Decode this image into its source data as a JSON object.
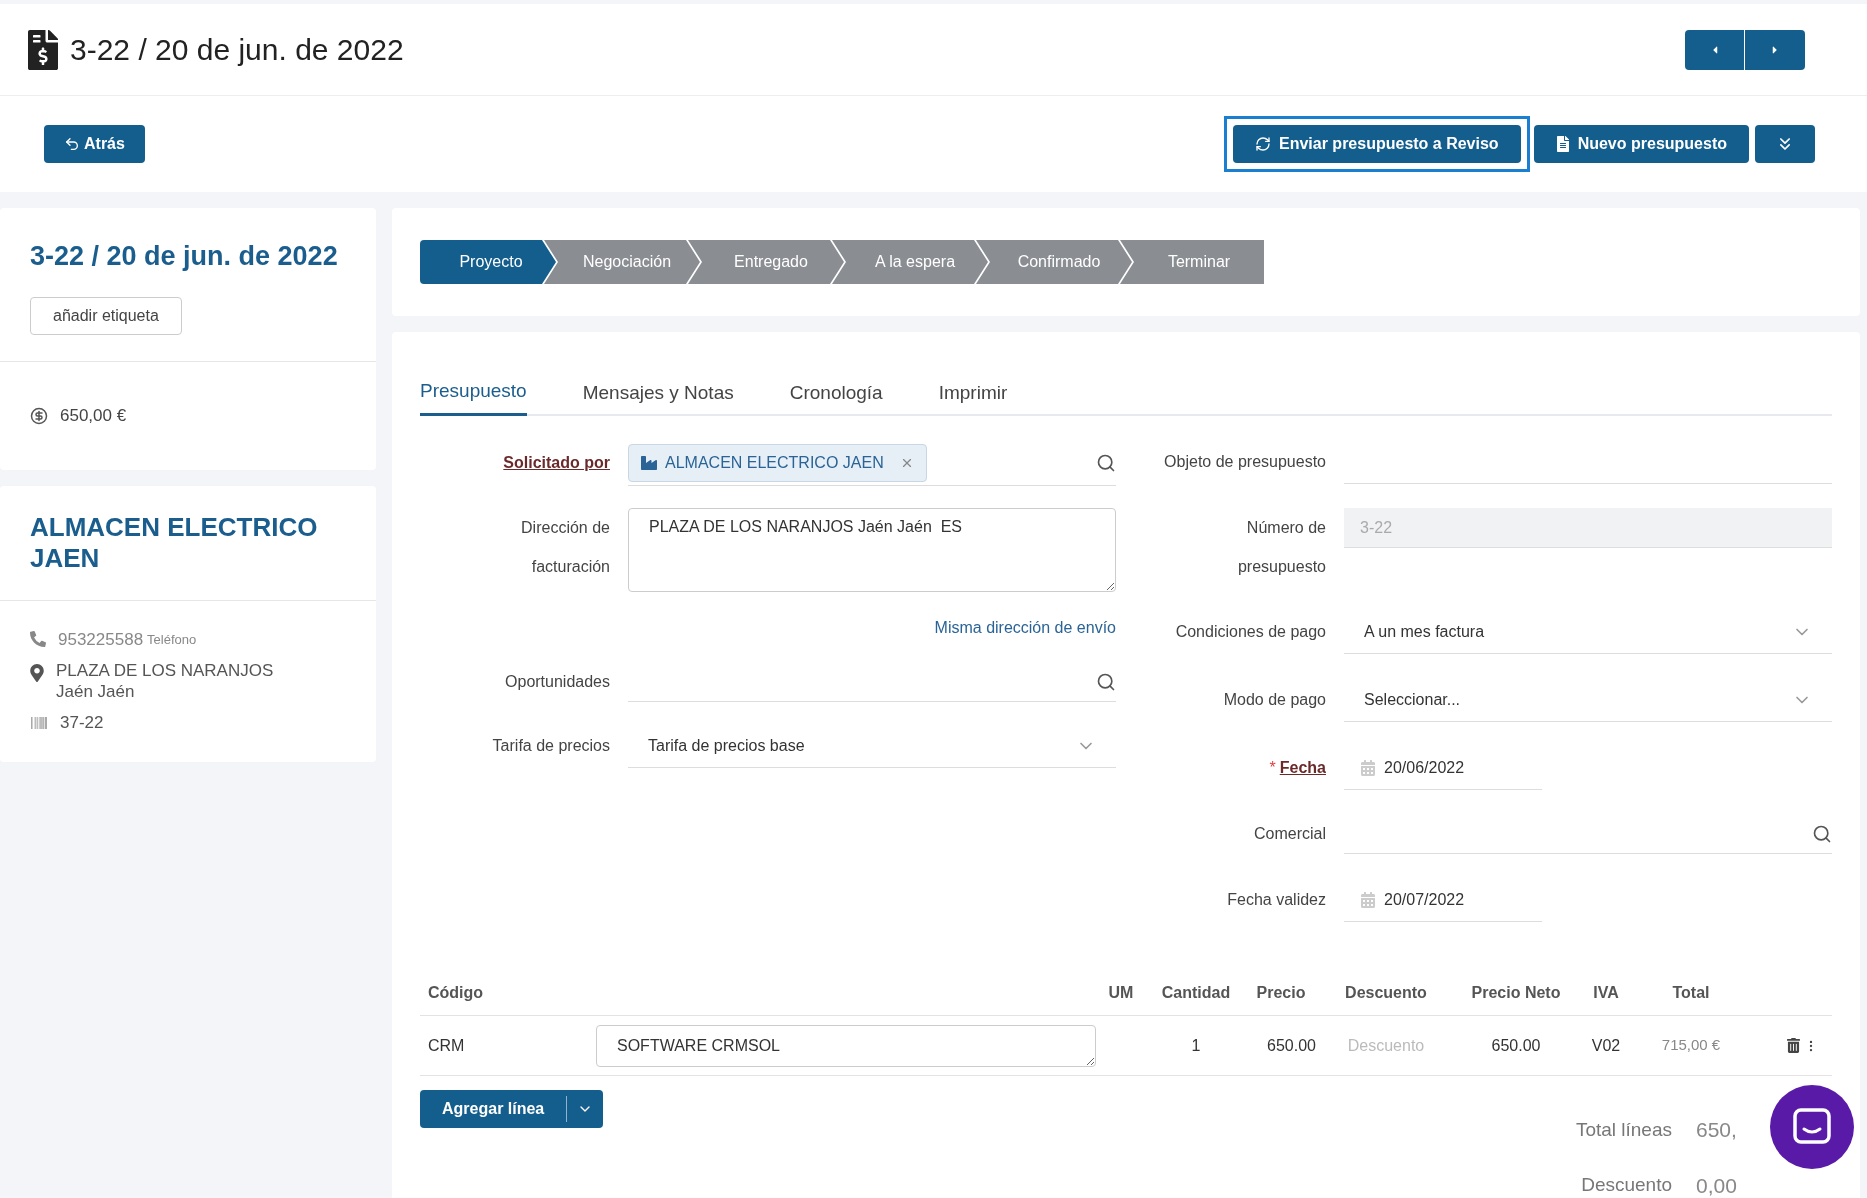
{
  "header": {
    "title": "3-22 / 20 de jun. de 2022"
  },
  "toolbar": {
    "back": "Atrás",
    "actions": [
      {
        "label": "Enviar presupuesto a Reviso",
        "kind": "sync",
        "highlighted": true
      },
      {
        "label": "Nuevo presupuesto",
        "kind": "new",
        "highlighted": false
      }
    ]
  },
  "summary_card": {
    "title": "3-22 / 20 de jun. de 2022",
    "tag_button": "añadir etiqueta",
    "amount": "650,00 €"
  },
  "customer_card": {
    "name": "ALMACEN ELECTRICO JAEN",
    "phone": "953225588",
    "phone_label": "Teléfono",
    "address_lines": [
      "PLAZA DE LOS NARANJOS",
      "Jaén Jaén"
    ],
    "code": "37-22"
  },
  "stages": [
    {
      "label": "Proyecto",
      "selected": true
    },
    {
      "label": "Negociación",
      "selected": false
    },
    {
      "label": "Entregado",
      "selected": false
    },
    {
      "label": "A la espera",
      "selected": false
    },
    {
      "label": "Confirmado",
      "selected": false
    },
    {
      "label": "Terminar",
      "selected": false
    }
  ],
  "tabs": [
    {
      "label": "Presupuesto",
      "selected": true
    },
    {
      "label": "Mensajes y Notas",
      "selected": false
    },
    {
      "label": "Cronología",
      "selected": false
    },
    {
      "label": "Imprimir",
      "selected": false
    }
  ],
  "form_left": [
    {
      "label": "Solicitado por",
      "link": true,
      "kind": "chip",
      "value": "ALMACEN ELECTRICO JAEN"
    },
    {
      "label": "Dirección de facturación",
      "link": false,
      "kind": "textarea",
      "value": "PLAZA DE LOS NARANJOS Jaén Jaén  ES"
    },
    {
      "kind": "link",
      "label": "Misma dirección de envío"
    },
    {
      "label": "Oportunidades",
      "link": false,
      "kind": "search"
    },
    {
      "label": "Tarifa de precios",
      "link": false,
      "kind": "select",
      "value": "Tarifa de precios base"
    }
  ],
  "form_right": [
    {
      "label": "Objeto de presupuesto",
      "kind": "text"
    },
    {
      "label": "Número de presupuesto",
      "kind": "readonly",
      "value": "3-22"
    },
    {
      "label": "Condiciones de pago",
      "kind": "select",
      "value": "A un mes factura"
    },
    {
      "label": "Modo de pago",
      "kind": "select",
      "value": "Seleccionar..."
    },
    {
      "label": "Fecha",
      "kind": "date",
      "value": "20/06/2022",
      "required_mark": "*",
      "link": true
    },
    {
      "label": "Comercial",
      "kind": "search"
    },
    {
      "label": "Fecha validez",
      "kind": "date",
      "value": "20/07/2022",
      "link": false
    }
  ],
  "table": {
    "columns": [
      "Código",
      "UM",
      "Cantidad",
      "Precio",
      "Descuento",
      "Precio Neto",
      "IVA",
      "Total"
    ],
    "rows": [
      {
        "code": "CRM",
        "description": "SOFTWARE CRMSOL",
        "quantity": "1",
        "price": "650.00",
        "discount_placeholder": "Descuento",
        "net_price": "650.00",
        "vat": "V02",
        "total": "715,00 €"
      }
    ]
  },
  "add_line": "Agregar línea",
  "totals": [
    {
      "label": "Total líneas",
      "value": "650,"
    },
    {
      "label": "Descuento",
      "value": "0,00"
    }
  ]
}
